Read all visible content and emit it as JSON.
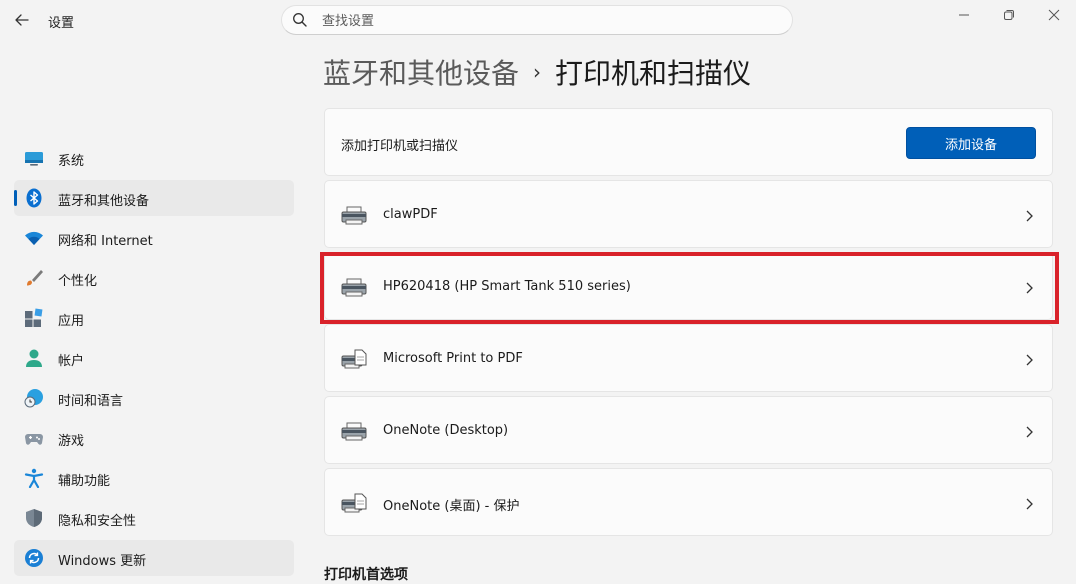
{
  "window": {
    "title": "设置",
    "back_icon": "arrow-left-icon",
    "controls": [
      "minimize-icon",
      "restore-icon",
      "close-icon"
    ]
  },
  "search": {
    "placeholder": "查找设置",
    "value": ""
  },
  "sidebar": {
    "items": [
      {
        "label": "系统",
        "icon": "display-icon"
      },
      {
        "label": "蓝牙和其他设备",
        "icon": "bluetooth-icon",
        "selected": true
      },
      {
        "label": "网络和 Internet",
        "icon": "wifi-icon"
      },
      {
        "label": "个性化",
        "icon": "brush-icon"
      },
      {
        "label": "应用",
        "icon": "apps-icon"
      },
      {
        "label": "帐户",
        "icon": "person-icon"
      },
      {
        "label": "时间和语言",
        "icon": "globe-clock-icon"
      },
      {
        "label": "游戏",
        "icon": "gamepad-icon"
      },
      {
        "label": "辅助功能",
        "icon": "accessibility-icon"
      },
      {
        "label": "隐私和安全性",
        "icon": "shield-icon"
      },
      {
        "label": "Windows 更新",
        "icon": "update-icon"
      }
    ]
  },
  "breadcrumb": {
    "parent": "蓝牙和其他设备",
    "separator": "›",
    "current": "打印机和扫描仪"
  },
  "add_device": {
    "label": "添加打印机或扫描仪",
    "button": "添加设备"
  },
  "devices": [
    {
      "name": "clawPDF",
      "icon": "printer-icon"
    },
    {
      "name": "HP620418 (HP Smart Tank 510 series)",
      "icon": "printer-icon",
      "highlighted": true
    },
    {
      "name": "Microsoft Print to PDF",
      "icon": "document-printer-icon"
    },
    {
      "name": "OneNote (Desktop)",
      "icon": "printer-icon"
    },
    {
      "name": "OneNote (桌面) - 保护",
      "icon": "document-printer-icon"
    }
  ],
  "next_section_heading": "打印机首选项",
  "colors": {
    "accent": "#005fb8",
    "highlight": "#d9222a",
    "background": "#f3f3f3",
    "card": "#fbfbfb"
  }
}
